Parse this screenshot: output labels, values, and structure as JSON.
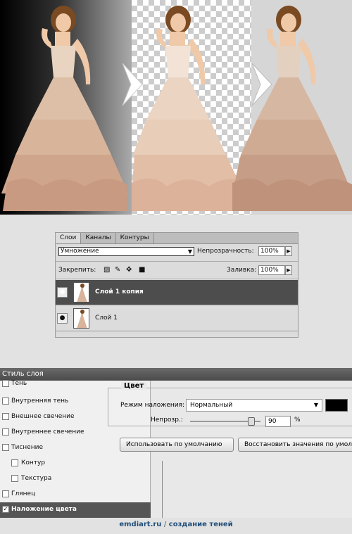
{
  "images": {
    "original": "woman-in-ruffled-gown-on-black",
    "extracted": "woman-in-ruffled-gown-on-transparent",
    "shadowed": "woman-in-ruffled-gown-with-shadow"
  },
  "layers_panel": {
    "tabs": [
      "Слои",
      "Каналы",
      "Контуры"
    ],
    "blend_mode": "Умножение",
    "opacity_label": "Непрозрачность:",
    "opacity_value": "100%",
    "lock_label": "Закрепить:",
    "fill_label": "Заливка:",
    "fill_value": "100%",
    "layers": [
      {
        "name": "Слой 1 копия",
        "selected": true
      },
      {
        "name": "Слой 1",
        "selected": false
      }
    ]
  },
  "layer_style": {
    "title": "Стиль слоя",
    "effects": [
      {
        "label": "Тень",
        "checked": false
      },
      {
        "label": "Внутренняя тень",
        "checked": false
      },
      {
        "label": "Внешнее свечение",
        "checked": false
      },
      {
        "label": "Внутреннее свечение",
        "checked": false
      },
      {
        "label": "Тиснение",
        "checked": false
      },
      {
        "label": "Контур",
        "checked": false
      },
      {
        "label": "Текстура",
        "checked": false
      },
      {
        "label": "Глянец",
        "checked": false
      },
      {
        "label": "Наложение цвета",
        "checked": true
      }
    ],
    "color_group": {
      "title": "Цвет",
      "blend_label": "Режим наложения:",
      "blend_value": "Нормальный",
      "swatch_color": "#000000",
      "opacity_label": "Непрозр.:",
      "opacity_value": "90",
      "opacity_unit": "%"
    },
    "buttons": {
      "default": "Использовать по умолчанию",
      "restore": "Восстановить значения по умол"
    }
  },
  "footer": {
    "site": "emdiart.ru",
    "sep": "/",
    "topic": "создание теней"
  }
}
